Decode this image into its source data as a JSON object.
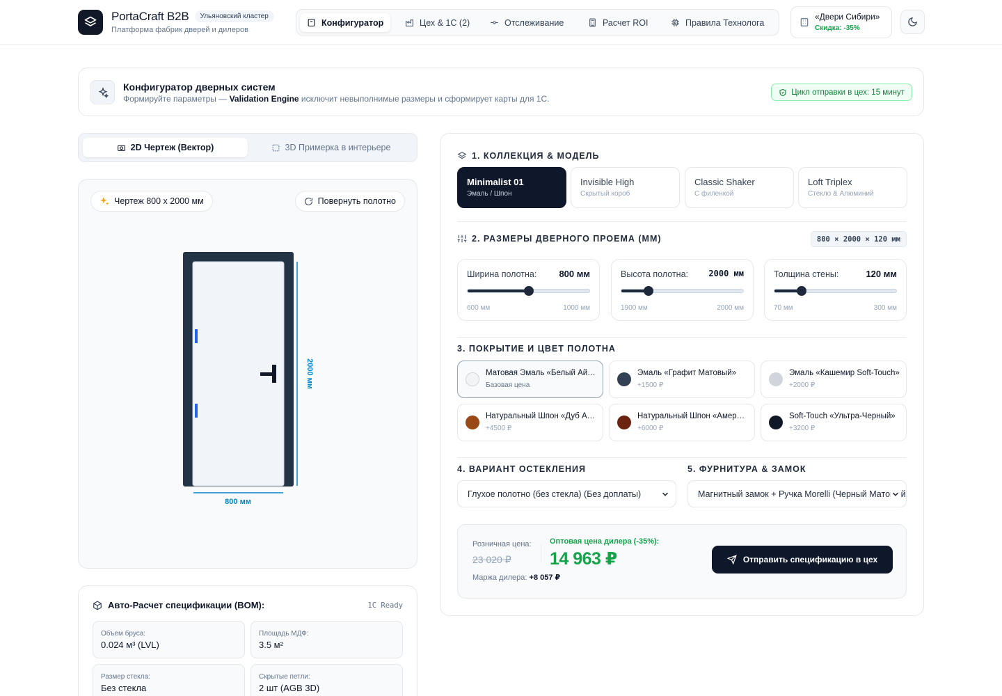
{
  "brand": {
    "name": "PortaCraft B2B",
    "badge": "Ульяновский кластер",
    "subtitle": "Платформа фабрик дверей и дилеров"
  },
  "nav": {
    "tabs": [
      {
        "label": "Конфигуратор",
        "icon": "door-icon",
        "active": true
      },
      {
        "label": "Цех & 1С (2)",
        "icon": "factory-icon",
        "active": false
      },
      {
        "label": "Отслеживание",
        "icon": "route-icon",
        "active": false
      },
      {
        "label": "Расчет ROI",
        "icon": "calculator-icon",
        "active": false
      },
      {
        "label": "Правила Технолога",
        "icon": "cpu-icon",
        "active": false
      }
    ]
  },
  "dealer": {
    "name": "«Двери Сибири»",
    "discount": "Скидка: -35%"
  },
  "hero": {
    "title": "Конфигуратор дверных систем",
    "subtitle_pre": "Формируйте параметры —",
    "subtitle_bold": "Validation Engine",
    "subtitle_post": "исключит невыполнимые размеры и сформирует карты для 1С.",
    "badge": "Цикл отправки в цех: 15 минут"
  },
  "view_tabs": [
    {
      "label": "2D Чертеж (Вектор)",
      "active": true
    },
    {
      "label": "3D Примерка в интерьере",
      "active": false
    }
  ],
  "drawing": {
    "label": "Чертеж 800 x 2000 мм",
    "rotate_label": "Повернуть полотно",
    "width_dim": "800 мм",
    "height_dim": "2000 мм"
  },
  "bom": {
    "title": "Авто-Расчет спецификации (BOM):",
    "status": "1C Ready",
    "cells": [
      {
        "label": "Объем бруса:",
        "value": "0.024 м³ (LVL)"
      },
      {
        "label": "Площадь МДФ:",
        "value": "3.5 м²"
      },
      {
        "label": "Размер стекла:",
        "value": "Без стекла"
      },
      {
        "label": "Скрытые петли:",
        "value": "2 шт (AGB 3D)"
      }
    ]
  },
  "config": {
    "section1": "1. КОЛЛЕКЦИЯ & МОДЕЛЬ",
    "models": [
      {
        "name": "Minimalist 01",
        "sub": "Эмаль / Шпон",
        "active": true
      },
      {
        "name": "Invisible High",
        "sub": "Скрытый короб",
        "active": false
      },
      {
        "name": "Classic Shaker",
        "sub": "С филенкой",
        "active": false
      },
      {
        "name": "Loft Triplex",
        "sub": "Стекло & Алюминий",
        "active": false
      }
    ],
    "section2": "2. РАЗМЕРЫ ДВЕРНОГО ПРОЕМА (ММ)",
    "dims_badge": "800 × 2000 × 120 мм",
    "dimensions": [
      {
        "label": "Ширина полотна:",
        "value": "800 мм",
        "min": "600 мм",
        "max": "1000 мм",
        "fraction": 0.5
      },
      {
        "label": "Высота полотна:",
        "value": "2000 мм",
        "min": "1900 мм",
        "max": "2000 мм",
        "fraction": 0.22
      },
      {
        "label": "Толщина стены:",
        "value": "120 мм",
        "min": "70 мм",
        "max": "300 мм",
        "fraction": 0.22
      }
    ],
    "section3": "3. ПОКРЫТИЕ И ЦВЕТ ПОЛОТНА",
    "finishes": [
      {
        "name": "Матовая Эмаль «Белый Айсберг»",
        "price": "Базовая цена",
        "color": "#f3f4f6",
        "active": true
      },
      {
        "name": "Эмаль «Графит Матовый»",
        "price": "+1500 ₽",
        "color": "#334155",
        "active": false
      },
      {
        "name": "Эмаль «Кашемир Soft-Touch»",
        "price": "+2000 ₽",
        "color": "#d1d5db",
        "active": false
      },
      {
        "name": "Натуральный Шпон «Дуб Античный»",
        "price": "+4500 ₽",
        "color": "#9a4a16",
        "active": false
      },
      {
        "name": "Натуральный Шпон «Американский Орех»",
        "price": "+6000 ₽",
        "color": "#6b2410",
        "active": false
      },
      {
        "name": "Soft-Touch «Ультра-Черный»",
        "price": "+3200 ₽",
        "color": "#111827",
        "active": false
      }
    ],
    "section4": "4. ВАРИАНТ ОСТЕКЛЕНИЯ",
    "glazing_value": "Глухое полотно (без стекла) (Без доплаты)",
    "section5": "5. ФУРНИТУРА & ЗАМОК",
    "hardware_value": "Магнитный замок + Ручка Morelli (Черный Матовый)"
  },
  "pricing": {
    "retail_label": "Розничная цена:",
    "retail_value": "23 020 ₽",
    "wholesale_label": "Оптовая цена дилера (-35%):",
    "wholesale_value": "14 963 ₽",
    "margin_label": "Маржа дилера:",
    "margin_value": "+8 057 ₽",
    "send_label": "Отправить спецификацию в цех"
  }
}
